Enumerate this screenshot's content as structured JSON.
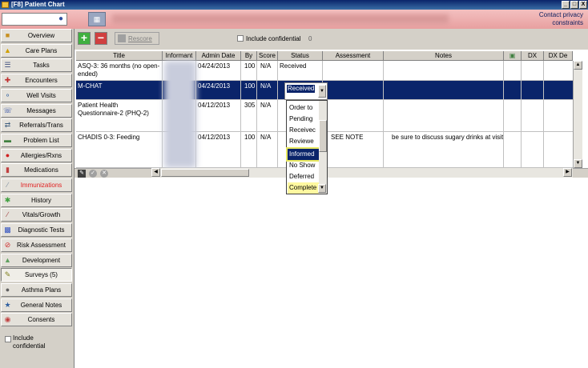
{
  "window": {
    "title": "[F8] Patient Chart",
    "controls": [
      "_",
      "□",
      "X"
    ]
  },
  "header": {
    "privacy_line1": "Contact privacy",
    "privacy_line2": "constraints"
  },
  "sidebar": {
    "items": [
      {
        "label": "Overview",
        "icon": "folder-icon"
      },
      {
        "label": "Care Plans",
        "icon": "warning-icon"
      },
      {
        "label": "Tasks",
        "icon": "tasks-icon"
      },
      {
        "label": "Encounters",
        "icon": "encounter-icon"
      },
      {
        "label": "Well Visits",
        "icon": "stethoscope-icon"
      },
      {
        "label": "Messages",
        "icon": "phone-icon"
      },
      {
        "label": "Referrals/Trans",
        "icon": "referral-icon"
      },
      {
        "label": "Problem List",
        "icon": "list-icon"
      },
      {
        "label": "Allergies/Rxns",
        "icon": "allergy-icon"
      },
      {
        "label": "Medications",
        "icon": "medication-icon"
      },
      {
        "label": "Immunizations",
        "icon": "syringe-icon"
      },
      {
        "label": "History",
        "icon": "history-icon"
      },
      {
        "label": "Vitals/Growth",
        "icon": "growth-icon"
      },
      {
        "label": "Diagnostic Tests",
        "icon": "test-icon"
      },
      {
        "label": "Risk Assessment",
        "icon": "risk-icon"
      },
      {
        "label": "Development",
        "icon": "development-icon"
      },
      {
        "label": "Surveys (5)",
        "icon": "survey-icon"
      },
      {
        "label": "Asthma Plans",
        "icon": "asthma-icon"
      },
      {
        "label": "General Notes",
        "icon": "notes-icon"
      },
      {
        "label": "Consents",
        "icon": "consent-icon"
      }
    ],
    "include_confidential_line1": "Include",
    "include_confidential_line2": "confidential"
  },
  "toolbar": {
    "add_label": "+",
    "remove_label": "−",
    "rescore_label": "Rescore",
    "include_confidential_label": "Include confidential",
    "confidential_count": "0"
  },
  "grid": {
    "columns": [
      "Title",
      "Informant",
      "Admin Date",
      "By",
      "Score",
      "Status",
      "Assessment",
      "Notes",
      "",
      "DX",
      "DX De"
    ],
    "rows": [
      {
        "title": "ASQ-3: 36 months (no open-ended)",
        "admin_date": "04/24/2013",
        "by": "100",
        "score": "N/A",
        "status": "Received",
        "assessment": "",
        "notes": ""
      },
      {
        "title": "M-CHAT",
        "admin_date": "04/24/2013",
        "by": "100",
        "score": "N/A",
        "status": "Received",
        "assessment": "",
        "notes": ""
      },
      {
        "title": "Patient Health Questionnaire-2 (PHQ-2)",
        "admin_date": "04/12/2013",
        "by": "305",
        "score": "N/A",
        "status": "",
        "assessment": "",
        "notes": ""
      },
      {
        "title": "CHADIS 0-3: Feeding",
        "admin_date": "04/12/2013",
        "by": "100",
        "score": "N/A",
        "status": "",
        "assessment": "SEE NOTE",
        "notes": "be sure to discuss sugary drinks at visit"
      }
    ]
  },
  "status_dropdown": {
    "selected": "Received",
    "options": [
      "Order to",
      "Pending",
      "Receivec",
      "Reviewe",
      "Informed",
      "No Show",
      "Deferred",
      "Complete"
    ],
    "highlighted_index": 4
  },
  "colors": {
    "selection": "#0a246a",
    "header_pink": "#e8a0a0",
    "highlight_yellow": "#e8e860"
  }
}
